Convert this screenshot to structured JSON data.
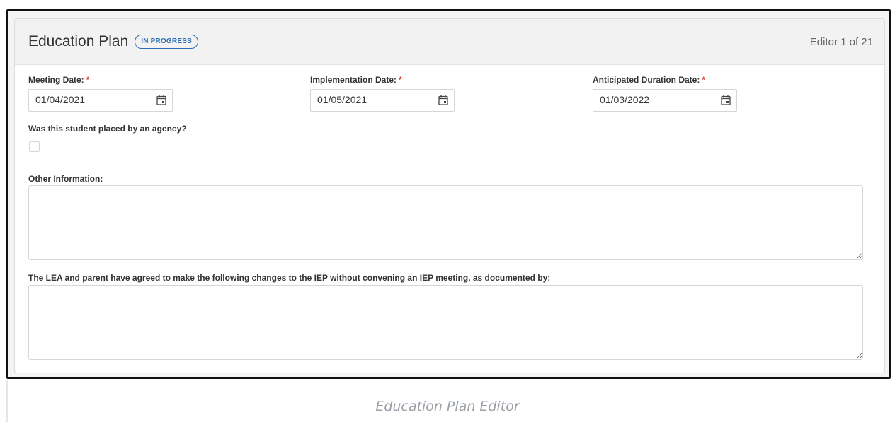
{
  "header": {
    "title": "Education Plan",
    "status_badge": "IN PROGRESS",
    "editor_count": "Editor 1 of 21"
  },
  "fields": {
    "meeting_date": {
      "label": "Meeting Date:",
      "required": "*",
      "value": "01/04/2021",
      "icon": "calendar-icon"
    },
    "implementation_date": {
      "label": "Implementation Date:",
      "required": "*",
      "value": "01/05/2021",
      "icon": "calendar-icon"
    },
    "anticipated_duration_date": {
      "label": "Anticipated Duration Date:",
      "required": "*",
      "value": "01/03/2022",
      "icon": "calendar-icon"
    },
    "placed_by_agency": {
      "label": "Was this student placed by an agency?",
      "checked": false
    },
    "other_information": {
      "label": "Other Information:",
      "value": ""
    },
    "changes_documented": {
      "label": "The LEA and parent have agreed to make the following changes to the IEP without convening an IEP meeting, as documented by:",
      "value": ""
    }
  },
  "caption": "Education Plan Editor",
  "colors": {
    "accent": "#2a6eb5",
    "required": "#d0312d",
    "header_bg": "#f2f2f2"
  }
}
